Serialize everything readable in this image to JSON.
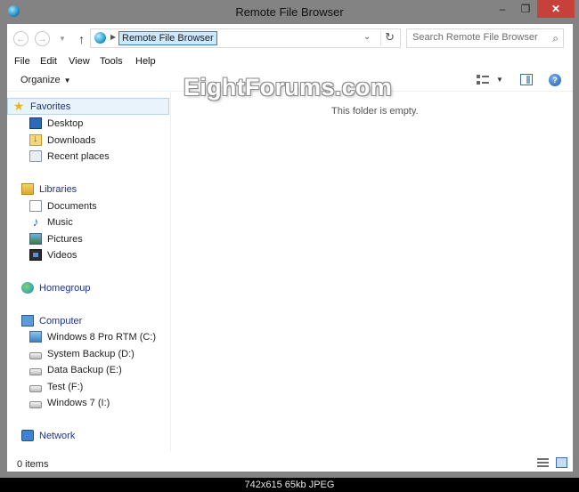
{
  "window": {
    "title": "Remote File Browser",
    "close_glyph": "✕",
    "min_glyph": "–",
    "max_glyph": "❐"
  },
  "address_bar": {
    "path_text": "Remote File Browser",
    "search_placeholder": "Search Remote File Browser"
  },
  "menu": [
    "File",
    "Edit",
    "View",
    "Tools",
    "Help"
  ],
  "command_bar": {
    "organize_label": "Organize"
  },
  "watermark": "EightForums.com",
  "nav": {
    "favorites": {
      "label": "Favorites",
      "items": [
        "Desktop",
        "Downloads",
        "Recent places"
      ]
    },
    "libraries": {
      "label": "Libraries",
      "items": [
        "Documents",
        "Music",
        "Pictures",
        "Videos"
      ]
    },
    "homegroup": {
      "label": "Homegroup"
    },
    "computer": {
      "label": "Computer",
      "items": [
        "Windows 8 Pro RTM (C:)",
        "System Backup (D:)",
        "Data Backup (E:)",
        "Test (F:)",
        "Windows 7 (I:)"
      ]
    },
    "network": {
      "label": "Network"
    }
  },
  "content": {
    "empty_message": "This folder is empty."
  },
  "status": {
    "items_count": "0 items"
  },
  "image_caption": "742x615  65kb  JPEG",
  "colors": {
    "selection_bg": "#e9f3fc",
    "selection_border": "#b4d4f3",
    "close_button": "#c7413b",
    "address_highlight": "#cce8ff",
    "chrome": "#838383"
  }
}
